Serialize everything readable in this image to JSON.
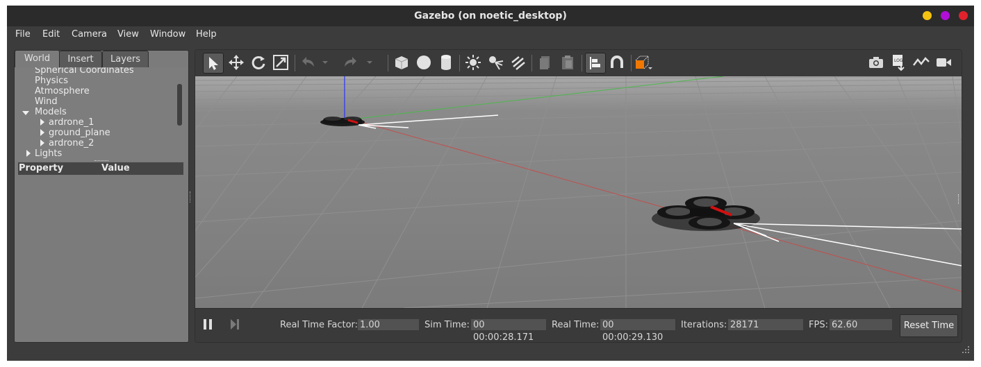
{
  "window": {
    "title": "Gazebo (on noetic_desktop)",
    "buttons": [
      {
        "name": "minimize",
        "color": "#f5c211"
      },
      {
        "name": "maximize",
        "color": "#b10fd6"
      },
      {
        "name": "close",
        "color": "#e0222c"
      }
    ]
  },
  "menu": [
    "File",
    "Edit",
    "Camera",
    "View",
    "Window",
    "Help"
  ],
  "left_panel": {
    "tabs": [
      "World",
      "Insert",
      "Layers"
    ],
    "active_tab": "World",
    "tree": [
      {
        "label": "Spherical Coordinates",
        "level": 1
      },
      {
        "label": "Physics",
        "level": 1
      },
      {
        "label": "Atmosphere",
        "level": 1
      },
      {
        "label": "Wind",
        "level": 1
      },
      {
        "label": "Models",
        "level": 1,
        "expanded": true
      },
      {
        "label": "ardrone_1",
        "level": 2,
        "collapsed": true
      },
      {
        "label": "ground_plane",
        "level": 2,
        "collapsed": true
      },
      {
        "label": "ardrone_2",
        "level": 2,
        "collapsed": true
      },
      {
        "label": "Lights",
        "level": 1,
        "collapsed": true
      }
    ],
    "property_header": {
      "property": "Property",
      "value": "Value"
    }
  },
  "toolbar": {
    "icons": [
      "select-arrow-icon",
      "translate-icon",
      "rotate-icon",
      "scale-icon",
      "undo-icon",
      "undo-dropdown-icon",
      "redo-icon",
      "redo-dropdown-icon",
      "box-icon",
      "sphere-icon",
      "cylinder-icon",
      "point-light-icon",
      "spot-light-icon",
      "directional-light-icon",
      "copy-icon",
      "paste-icon",
      "align-icon",
      "snap-icon",
      "view-angle-icon",
      "screenshot-icon",
      "log-icon",
      "plot-icon",
      "video-record-icon"
    ],
    "accent_orange": "#f07800"
  },
  "status": {
    "real_time_factor_label": "Real Time Factor:",
    "real_time_factor": "1.00",
    "sim_time_label": "Sim Time:",
    "sim_time": "00 00:00:28.171",
    "real_time_label": "Real Time:",
    "real_time": "00 00:00:29.130",
    "iterations_label": "Iterations:",
    "iterations": "28171",
    "fps_label": "FPS:",
    "fps": "62.60",
    "reset_label": "Reset Time"
  }
}
